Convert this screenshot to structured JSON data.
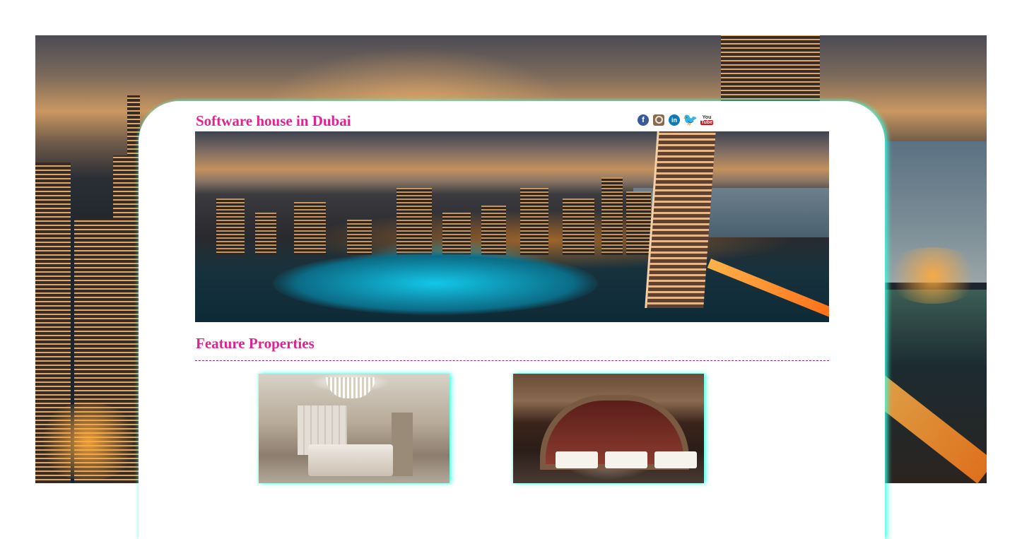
{
  "header": {
    "site_title": "Software house in Dubai"
  },
  "social": [
    {
      "name": "facebook",
      "glyph": "f"
    },
    {
      "name": "instagram",
      "glyph": ""
    },
    {
      "name": "linkedin",
      "glyph": "in"
    },
    {
      "name": "twitter",
      "glyph": "🐦"
    },
    {
      "name": "youtube",
      "glyph_top": "You",
      "glyph_bottom": "Tube"
    }
  ],
  "hero": {
    "icon": "dubai-marina-banner-image"
  },
  "features": {
    "title": "Feature Properties",
    "properties": [
      {
        "icon": "luxury-bedroom-image"
      },
      {
        "icon": "restaurant-interior-image"
      }
    ]
  },
  "colors": {
    "accent": "#e0248f",
    "glow": "#3cffe1"
  }
}
